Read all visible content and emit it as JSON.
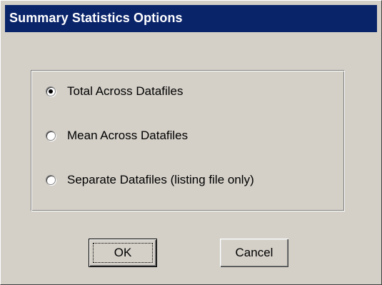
{
  "window": {
    "title": "Summary Statistics Options",
    "colors": {
      "titlebar": "#0a246a",
      "face": "#d4d0c8"
    }
  },
  "options": {
    "selected": "total_across",
    "items": [
      {
        "id": "total_across",
        "label": "Total Across Datafiles",
        "checked": true
      },
      {
        "id": "mean_across",
        "label": "Mean Across Datafiles",
        "checked": false
      },
      {
        "id": "separate",
        "label": "Separate Datafiles (listing file only)",
        "checked": false
      }
    ]
  },
  "buttons": {
    "ok_label": "OK",
    "cancel_label": "Cancel",
    "default": "ok"
  }
}
